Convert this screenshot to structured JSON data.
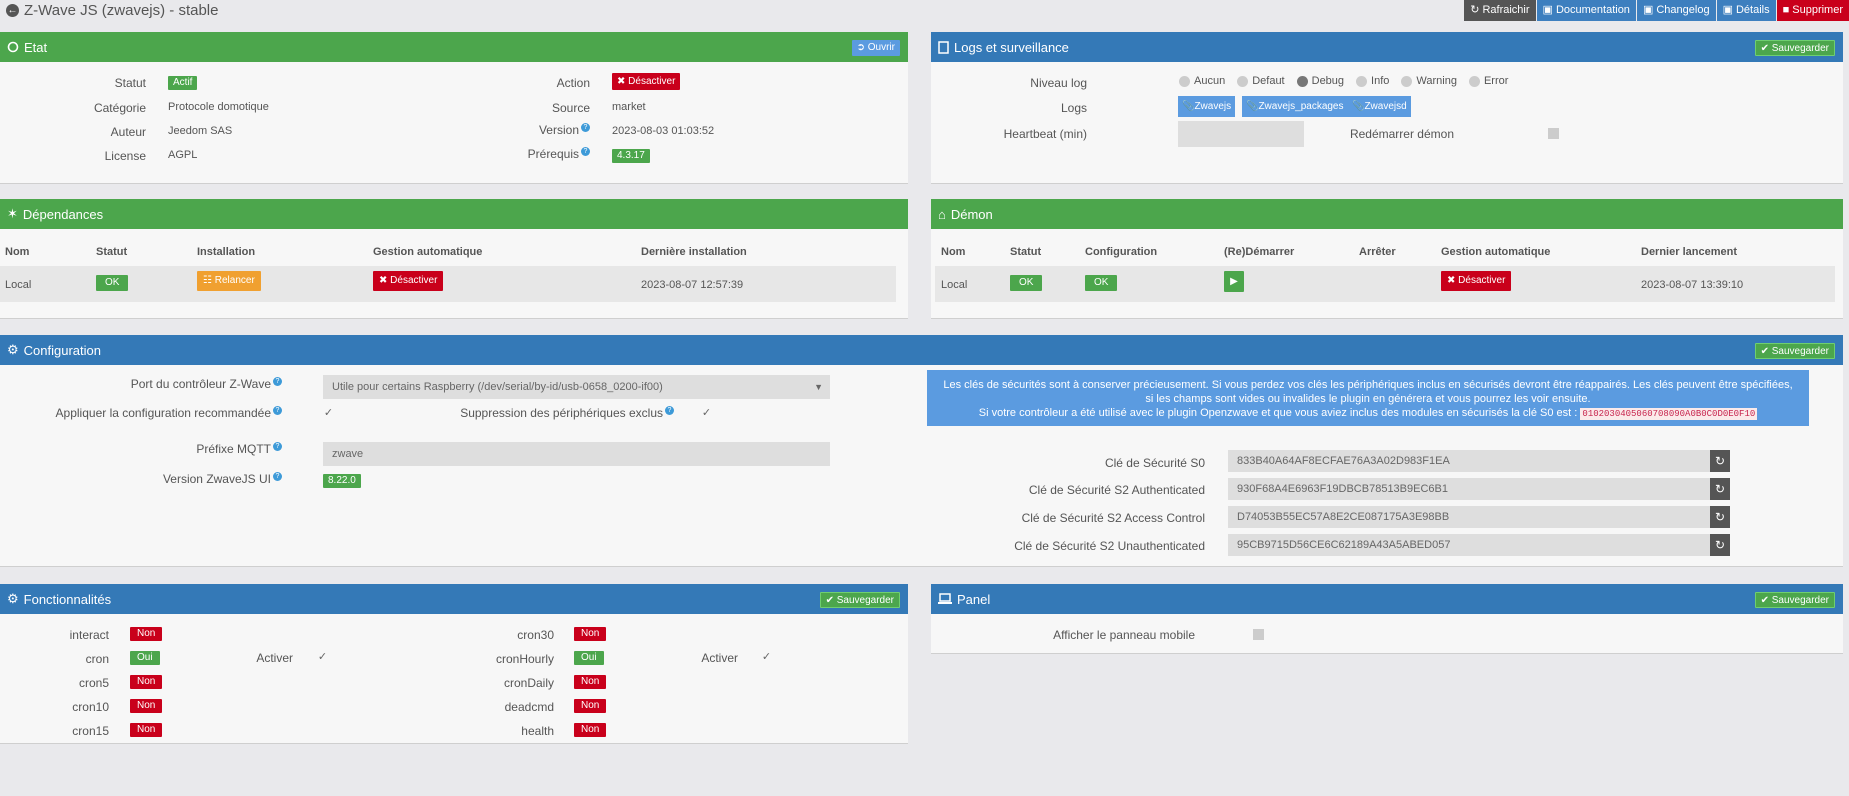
{
  "page": {
    "title": "Z-Wave JS (zwavejs) - stable"
  },
  "toolbar": {
    "refresh": "Rafraichir",
    "documentation": "Documentation",
    "changelog": "Changelog",
    "details": "Détails",
    "delete": "Supprimer"
  },
  "etat": {
    "title": "Etat",
    "open": "Ouvrir",
    "statut_label": "Statut",
    "statut": "Actif",
    "categorie_label": "Catégorie",
    "categorie": "Protocole domotique",
    "auteur_label": "Auteur",
    "auteur": "Jeedom SAS",
    "license_label": "License",
    "license": "AGPL",
    "action_label": "Action",
    "action": "Désactiver",
    "source_label": "Source",
    "source": "market",
    "version_label": "Version",
    "version": "2023-08-03 01:03:52",
    "prerequis_label": "Prérequis",
    "prerequis": "4.3.17"
  },
  "logs": {
    "title": "Logs et surveillance",
    "save": "Sauvegarder",
    "niveau_label": "Niveau log",
    "levels": [
      "Aucun",
      "Defaut",
      "Debug",
      "Info",
      "Warning",
      "Error"
    ],
    "selected": "Debug",
    "logs_label": "Logs",
    "log_buttons": [
      "Zwavejs",
      "Zwavejs_packages",
      "Zwavejsd"
    ],
    "heartbeat_label": "Heartbeat (min)",
    "heartbeat_value": "",
    "restart_label": "Redémarrer démon"
  },
  "deps": {
    "title": "Dépendances",
    "headers": [
      "Nom",
      "Statut",
      "Installation",
      "Gestion automatique",
      "Dernière installation"
    ],
    "row": {
      "nom": "Local",
      "statut": "OK",
      "installation": "Relancer",
      "gestion": "Désactiver",
      "date": "2023-08-07 12:57:39"
    }
  },
  "demon": {
    "title": "Démon",
    "headers": [
      "Nom",
      "Statut",
      "Configuration",
      "(Re)Démarrer",
      "Arrêter",
      "Gestion automatique",
      "Dernier lancement"
    ],
    "row": {
      "nom": "Local",
      "statut": "OK",
      "configuration": "OK",
      "gestion": "Désactiver",
      "date": "2023-08-07 13:39:10"
    }
  },
  "config": {
    "title": "Configuration",
    "save": "Sauvegarder",
    "port_label": "Port du contrôleur Z-Wave",
    "port_value": "Utile pour certains Raspberry (/dev/serial/by-id/usb-0658_0200-if00)",
    "apply_label": "Appliquer la configuration recommandée",
    "suppr_label": "Suppression des périphériques exclus",
    "mqtt_label": "Préfixe MQTT",
    "mqtt_value": "zwave",
    "ui_label": "Version ZwaveJS UI",
    "ui_value": "8.22.0",
    "info_line1": "Les clés de sécurités sont à conserver précieusement. Si vous perdez vos clés les périphériques inclus en sécurisés devront être réappairés. Les clés peuvent être spécifiées,",
    "info_line2": "si les champs sont vides ou invalides le plugin en générera et vous pourrez les voir ensuite.",
    "info_line3": "Si votre contrôleur a été utilisé avec le plugin Openzwave et que vous aviez inclus des modules en sécurisés la clé S0 est :",
    "info_code": "0102030405060708090A0B0C0D0E0F10",
    "keys": [
      {
        "label": "Clé de Sécurité S0",
        "value": "833B40A64AF8ECFAE76A3A02D983F1EA"
      },
      {
        "label": "Clé de Sécurité S2 Authenticated",
        "value": "930F68A4E6963F19DBCB78513B9EC6B1"
      },
      {
        "label": "Clé de Sécurité S2 Access Control",
        "value": "D74053B55EC57A8E2CE087175A3E98BB"
      },
      {
        "label": "Clé de Sécurité S2 Unauthenticated",
        "value": "95CB9715D56CE6C62189A43A5ABED057"
      }
    ]
  },
  "fonct": {
    "title": "Fonctionnalités",
    "save": "Sauvegarder",
    "activer": "Activer",
    "left": [
      {
        "name": "interact",
        "val": "Non"
      },
      {
        "name": "cron",
        "val": "Oui"
      },
      {
        "name": "cron5",
        "val": "Non"
      },
      {
        "name": "cron10",
        "val": "Non"
      },
      {
        "name": "cron15",
        "val": "Non"
      }
    ],
    "right": [
      {
        "name": "cron30",
        "val": "Non"
      },
      {
        "name": "cronHourly",
        "val": "Oui"
      },
      {
        "name": "cronDaily",
        "val": "Non"
      },
      {
        "name": "deadcmd",
        "val": "Non"
      },
      {
        "name": "health",
        "val": "Non"
      }
    ]
  },
  "panel": {
    "title": "Panel",
    "save": "Sauvegarder",
    "mobile_label": "Afficher le panneau mobile"
  },
  "colors": {
    "green": "#4ca64c",
    "blue": "#3479b7",
    "red": "#c9001b",
    "orange": "#f0a030",
    "light_blue": "#5b9be0"
  }
}
